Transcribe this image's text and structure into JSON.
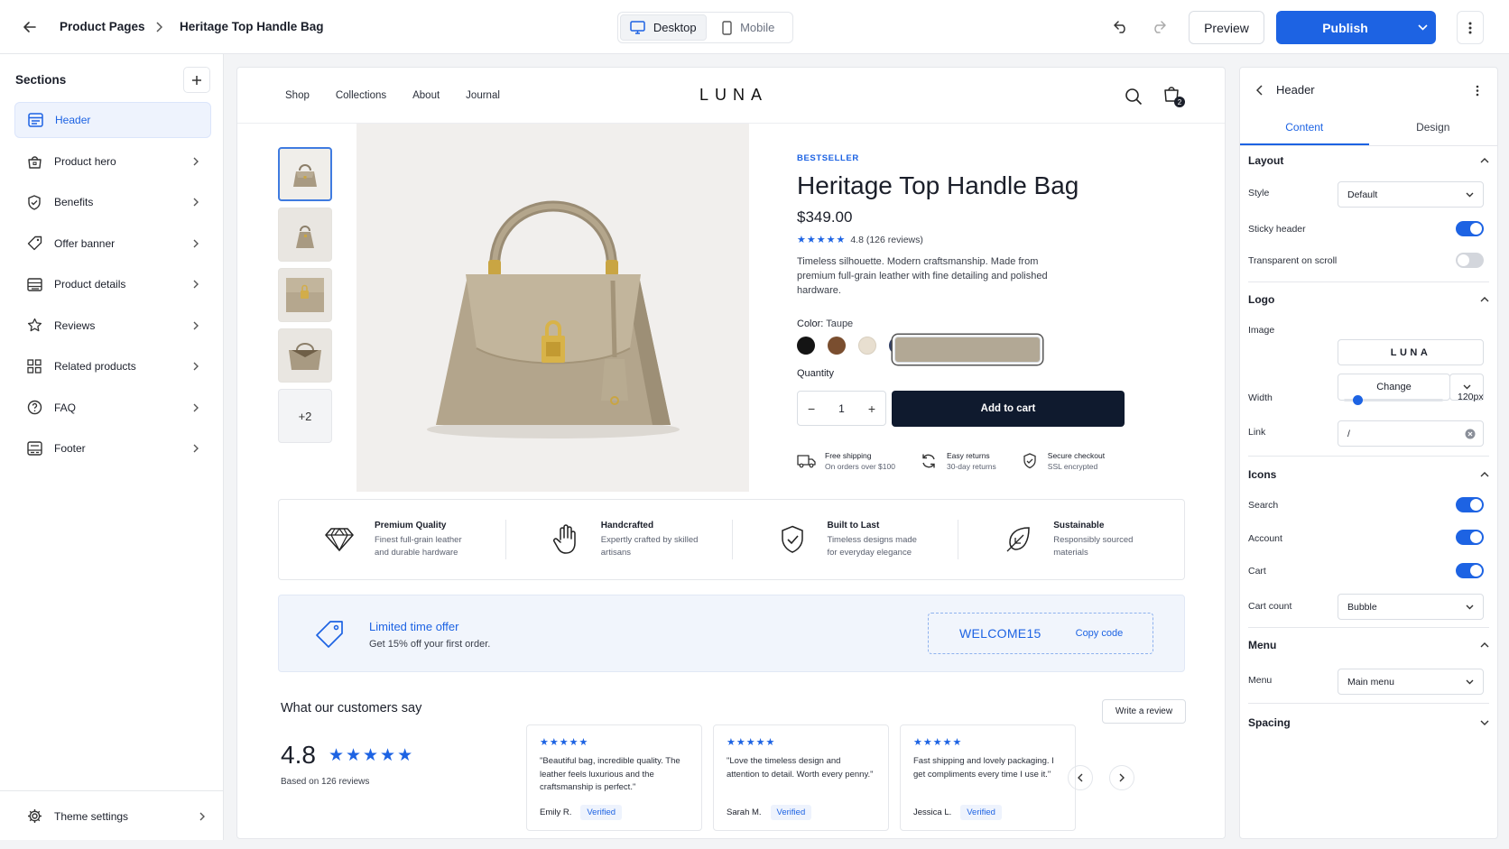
{
  "topbar": {
    "breadcrumb_parent": "Product Pages",
    "breadcrumb_current": "Heritage Top Handle Bag",
    "device_desktop": "Desktop",
    "device_mobile": "Mobile",
    "preview_label": "Preview",
    "publish_label": "Publish"
  },
  "sidebar": {
    "title": "Sections",
    "items": [
      {
        "label": "Header",
        "icon": "layout-header-icon"
      },
      {
        "label": "Product hero",
        "icon": "shopping-bag-icon"
      },
      {
        "label": "Benefits",
        "icon": "shield-check-icon"
      },
      {
        "label": "Offer banner",
        "icon": "tag-icon"
      },
      {
        "label": "Product details",
        "icon": "list-details-icon"
      },
      {
        "label": "Reviews",
        "icon": "star-icon"
      },
      {
        "label": "Related products",
        "icon": "grid-icon"
      },
      {
        "label": "FAQ",
        "icon": "question-icon"
      },
      {
        "label": "Footer",
        "icon": "layout-footer-icon"
      }
    ],
    "theme_settings": "Theme settings"
  },
  "store": {
    "nav": [
      "Shop",
      "Collections",
      "About",
      "Journal"
    ],
    "logo": "LUNA",
    "cart_count": "2",
    "thumb_more": "+2",
    "product": {
      "badge": "BESTSELLER",
      "title": "Heritage Top Handle Bag",
      "price": "$349.00",
      "stars": "★★★★★",
      "rating": "4.8",
      "reviews": "(126 reviews)",
      "description": "Timeless silhouette. Modern craftsmanship. Made from premium full-grain leather with fine detailing and polished hardware.",
      "color_label": "Color:",
      "color_value": "Taupe",
      "swatches": [
        "#b2a895",
        "#141414",
        "#7a4e2f",
        "#e8dfd0",
        "#2f3d63"
      ],
      "quantity_label": "Quantity",
      "quantity": "1",
      "add_to_cart": "Add to cart"
    },
    "perks": [
      {
        "title": "Free shipping",
        "sub": "On orders over $100",
        "icon": "truck-icon"
      },
      {
        "title": "Easy returns",
        "sub": "30-day returns",
        "icon": "refresh-icon"
      },
      {
        "title": "Secure checkout",
        "sub": "SSL encrypted",
        "icon": "shield-check-icon"
      }
    ],
    "benefits": [
      {
        "title": "Premium Quality",
        "sub": "Finest full-grain leather and durable hardware",
        "icon": "diamond-icon"
      },
      {
        "title": "Handcrafted",
        "sub": "Expertly crafted by skilled artisans",
        "icon": "hand-icon"
      },
      {
        "title": "Built to Last",
        "sub": "Timeless designs made for everyday elegance",
        "icon": "shield-check-icon"
      },
      {
        "title": "Sustainable",
        "sub": "Responsibly sourced materials",
        "icon": "leaf-icon"
      }
    ],
    "offer": {
      "title": "Limited time offer",
      "sub": "Get 15% off your first order.",
      "code": "WELCOME15",
      "copy": "Copy code"
    },
    "reviews": {
      "title": "What our customers say",
      "score": "4.8",
      "stars": "★★★★★",
      "based_on": "Based on 126 reviews",
      "write": "Write a review",
      "cards": [
        {
          "stars": "★★★★★",
          "text": "\"Beautiful bag, incredible quality. The leather feels luxurious and the craftsmanship is perfect.\"",
          "author": "Emily R.",
          "verified": "Verified"
        },
        {
          "stars": "★★★★★",
          "text": "\"Love the timeless design and attention to detail. Worth every penny.\"",
          "author": "Sarah M.",
          "verified": "Verified"
        },
        {
          "stars": "★★★★★",
          "text": "Fast shipping and lovely packaging. I get compliments every time I use it.\"",
          "author": "Jessica L.",
          "verified": "Verified"
        }
      ]
    }
  },
  "panel": {
    "title": "Header",
    "tabs": [
      "Content",
      "Design"
    ],
    "layout": {
      "heading": "Layout",
      "style_label": "Style",
      "style_value": "Default",
      "sticky_label": "Sticky header",
      "sticky_on": true,
      "transparent_label": "Transparent on scroll",
      "transparent_on": false
    },
    "logo": {
      "heading": "Logo",
      "image_label": "Image",
      "image_value": "LUNA",
      "change_label": "Change",
      "width_label": "Width",
      "width_value": "120px",
      "width_fraction": 0.1,
      "link_label": "Link",
      "link_value": "/"
    },
    "icons": {
      "heading": "Icons",
      "search_label": "Search",
      "search_on": true,
      "account_label": "Account",
      "account_on": true,
      "cart_label": "Cart",
      "cart_on": true,
      "cart_count_label": "Cart count",
      "cart_count_value": "Bubble"
    },
    "menu": {
      "heading": "Menu",
      "menu_label": "Menu",
      "menu_value": "Main menu"
    },
    "spacing": {
      "heading": "Spacing"
    }
  },
  "colors": {
    "accent": "#1d63e3",
    "dark_button": "#0f1a2e"
  }
}
